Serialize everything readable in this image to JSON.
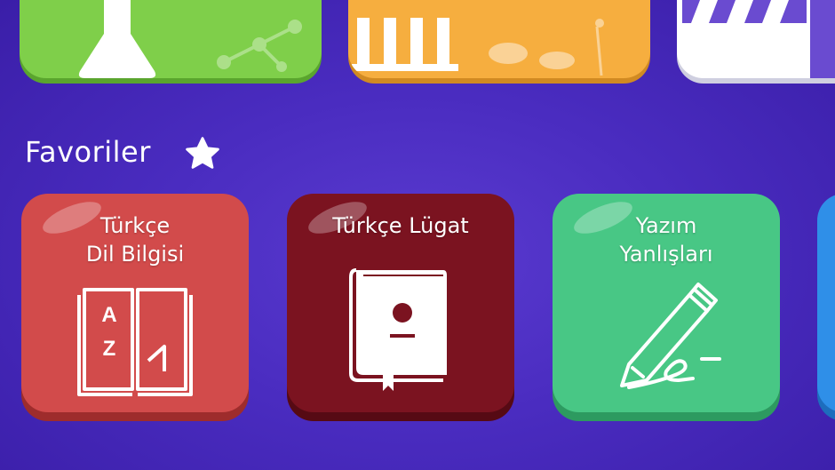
{
  "section": {
    "title": "Favoriler",
    "icon": "star-icon"
  },
  "top_row": [
    {
      "name": "science-card",
      "icon": "flask-icon",
      "color": "#7fcf4a"
    },
    {
      "name": "history-card",
      "icon": "temple-icon",
      "color": "#f6ae3f"
    },
    {
      "name": "film-card",
      "icon": "clapperboard-icon",
      "color": "#ffffff"
    }
  ],
  "favorites": [
    {
      "line1": "Türkçe",
      "line2": "Dil Bilgisi",
      "icon": "book-az-icon",
      "color": "#d24b4b"
    },
    {
      "line1": "Türkçe Lügat",
      "line2": "",
      "icon": "dictionary-icon",
      "color": "#7b1320"
    },
    {
      "line1": "Yazım",
      "line2": "Yanlışları",
      "icon": "pen-icon",
      "color": "#48c785"
    },
    {
      "line1": "",
      "line2": "",
      "icon": "",
      "color": "#2f8fe8"
    }
  ]
}
